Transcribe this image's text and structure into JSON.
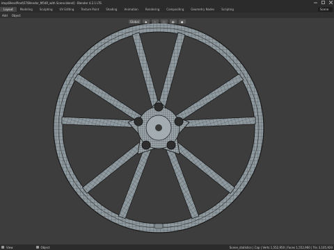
{
  "window": {
    "title": "ktop\\BlendProd\\57\\Blender_M54R_with Scene.blend] - Blender 4.2.1 LTS"
  },
  "workspaces": [
    {
      "label": "Layout",
      "active": true
    },
    {
      "label": "Modeling",
      "active": false
    },
    {
      "label": "Sculpting",
      "active": false
    },
    {
      "label": "UV Editing",
      "active": false
    },
    {
      "label": "Texture Paint",
      "active": false
    },
    {
      "label": "Shading",
      "active": false
    },
    {
      "label": "Animation",
      "active": false
    },
    {
      "label": "Rendering",
      "active": false
    },
    {
      "label": "Compositing",
      "active": false
    },
    {
      "label": "Geometry Nodes",
      "active": false
    },
    {
      "label": "Scripting",
      "active": false
    }
  ],
  "scene_box": {
    "label": "Scene"
  },
  "viewport_header": {
    "items": [
      "Add",
      "Object"
    ]
  },
  "transform": {
    "orientation_label": "Global"
  },
  "status": {
    "left_label": "View",
    "mode_label": "Object",
    "scene_info": "Scene_statistics | Cap | Verts 1,552,950 | Faces 1,552,960 | Tris 3,105,920"
  },
  "colors": {
    "viewport_bg": "#3d3d3d",
    "mesh_face": "#8e9aa0",
    "mesh_wire": "#1a1a1a",
    "title_bg": "#2b2b2b"
  }
}
